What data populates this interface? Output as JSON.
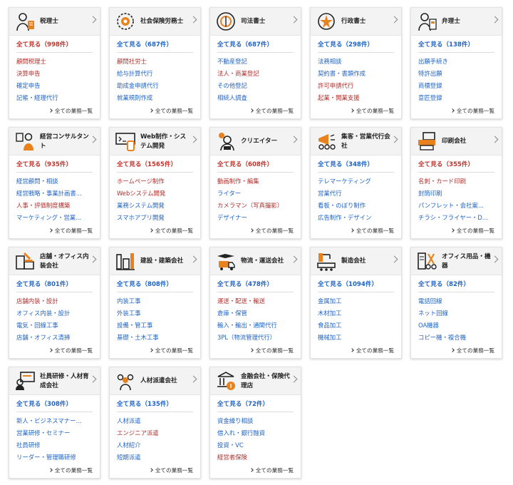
{
  "more_label": "全ての業務一覧",
  "colors": {
    "red": "#b0302c",
    "blue": "#1f64c4",
    "orange": "#e8821e"
  },
  "cards": [
    {
      "title": "税理士",
      "icon": "tax-accountant-icon",
      "see_all": "全て見る（998件）",
      "tone": "red",
      "items": [
        {
          "t": "顧問税理士",
          "c": "red"
        },
        {
          "t": "決算申告",
          "c": "red"
        },
        {
          "t": "確定申告",
          "c": "blue"
        },
        {
          "t": "記帳・経理代行",
          "c": "blue"
        }
      ]
    },
    {
      "title": "社会保険労務士",
      "icon": "labor-consultant-icon",
      "see_all": "全て見る（687件）",
      "tone": "blue",
      "items": [
        {
          "t": "顧問社労士",
          "c": "red"
        },
        {
          "t": "給与計算代行",
          "c": "blue"
        },
        {
          "t": "助成金申請代行",
          "c": "blue"
        },
        {
          "t": "就業規則作成",
          "c": "blue"
        }
      ]
    },
    {
      "title": "司法書士",
      "icon": "judicial-scrivener-icon",
      "see_all": "全て見る（687件）",
      "tone": "blue",
      "items": [
        {
          "t": "不動産登記",
          "c": "blue"
        },
        {
          "t": "法人・商業登記",
          "c": "red"
        },
        {
          "t": "その他登記",
          "c": "blue"
        },
        {
          "t": "相続人調査",
          "c": "blue"
        }
      ]
    },
    {
      "title": "行政書士",
      "icon": "administrative-scrivener-icon",
      "see_all": "全て見る（298件）",
      "tone": "blue",
      "items": [
        {
          "t": "法務相談",
          "c": "blue"
        },
        {
          "t": "契約書・書類作成",
          "c": "blue"
        },
        {
          "t": "許可申請代行",
          "c": "red"
        },
        {
          "t": "起業・開業支援",
          "c": "red"
        }
      ]
    },
    {
      "title": "弁理士",
      "icon": "patent-attorney-icon",
      "see_all": "全て見る（138件）",
      "tone": "blue",
      "items": [
        {
          "t": "出願手続き",
          "c": "blue"
        },
        {
          "t": "特許出願",
          "c": "blue"
        },
        {
          "t": "商標登録",
          "c": "blue"
        },
        {
          "t": "意匠登録",
          "c": "blue"
        }
      ]
    },
    {
      "title": "経営コンサルタント",
      "icon": "management-consultant-icon",
      "see_all": "全て見る（935件）",
      "tone": "red",
      "items": [
        {
          "t": "経営顧問・相談",
          "c": "blue"
        },
        {
          "t": "経営戦略・事業計画書...",
          "c": "blue"
        },
        {
          "t": "人事・評価制度構築",
          "c": "red"
        },
        {
          "t": "マーケティング・営業...",
          "c": "blue"
        }
      ]
    },
    {
      "title": "Web制作・システム開発",
      "icon": "web-development-icon",
      "see_all": "全て見る（1565件）",
      "tone": "red",
      "items": [
        {
          "t": "ホームページ制作",
          "c": "red"
        },
        {
          "t": "Webシステム開発",
          "c": "red"
        },
        {
          "t": "業務システム開発",
          "c": "blue"
        },
        {
          "t": "スマホアプリ開発",
          "c": "blue"
        }
      ]
    },
    {
      "title": "クリエイター",
      "icon": "creator-icon",
      "see_all": "全て見る（608件）",
      "tone": "red",
      "items": [
        {
          "t": "動画制作・編集",
          "c": "red"
        },
        {
          "t": "ライター",
          "c": "blue"
        },
        {
          "t": "カメラマン（写真撮影）",
          "c": "red"
        },
        {
          "t": "デザイナー",
          "c": "blue"
        }
      ]
    },
    {
      "title": "集客・営業代行会社",
      "icon": "sales-agency-icon",
      "see_all": "全て見る（348件）",
      "tone": "blue",
      "items": [
        {
          "t": "テレマーケティング",
          "c": "blue"
        },
        {
          "t": "営業代行",
          "c": "blue"
        },
        {
          "t": "看板・のぼり制作",
          "c": "blue"
        },
        {
          "t": "広告制作・デザイン",
          "c": "blue"
        }
      ]
    },
    {
      "title": "印刷会社",
      "icon": "printing-company-icon",
      "see_all": "全て見る（355件）",
      "tone": "red",
      "items": [
        {
          "t": "名刺・カード印刷",
          "c": "red"
        },
        {
          "t": "封筒印刷",
          "c": "blue"
        },
        {
          "t": "パンフレット・会社案...",
          "c": "blue"
        },
        {
          "t": "チラシ・フライヤー・D...",
          "c": "blue"
        }
      ]
    },
    {
      "title": "店舗・オフィス内装会社",
      "icon": "interior-company-icon",
      "see_all": "全て見る（801件）",
      "tone": "blue",
      "items": [
        {
          "t": "店舗内装・設計",
          "c": "red"
        },
        {
          "t": "オフィス内装・設計",
          "c": "blue"
        },
        {
          "t": "電気・回線工事",
          "c": "blue"
        },
        {
          "t": "店舗・オフィス清掃",
          "c": "blue"
        }
      ]
    },
    {
      "title": "建設・建築会社",
      "icon": "construction-company-icon",
      "see_all": "全て見る（808件）",
      "tone": "blue",
      "items": [
        {
          "t": "内装工事",
          "c": "blue"
        },
        {
          "t": "外装工事",
          "c": "blue"
        },
        {
          "t": "設備・管工事",
          "c": "blue"
        },
        {
          "t": "基礎・土木工事",
          "c": "blue"
        }
      ]
    },
    {
      "title": "物流・運送会社",
      "icon": "logistics-company-icon",
      "see_all": "全て見る（478件）",
      "tone": "blue",
      "items": [
        {
          "t": "運送・配送・輸送",
          "c": "red"
        },
        {
          "t": "倉庫・保管",
          "c": "blue"
        },
        {
          "t": "輸入・輸出・通関代行",
          "c": "blue"
        },
        {
          "t": "3PL（物流管理代行）",
          "c": "blue"
        }
      ]
    },
    {
      "title": "製造会社",
      "icon": "manufacturing-company-icon",
      "see_all": "全て見る（1094件）",
      "tone": "blue",
      "items": [
        {
          "t": "金属加工",
          "c": "blue"
        },
        {
          "t": "木材加工",
          "c": "blue"
        },
        {
          "t": "食品加工",
          "c": "blue"
        },
        {
          "t": "機械加工",
          "c": "blue"
        }
      ]
    },
    {
      "title": "オフィス用品・機器",
      "icon": "office-supplies-icon",
      "see_all": "全て見る（82件）",
      "tone": "blue",
      "items": [
        {
          "t": "電話回線",
          "c": "blue"
        },
        {
          "t": "ネット回線",
          "c": "blue"
        },
        {
          "t": "OA機器",
          "c": "blue"
        },
        {
          "t": "コピー機・複合機",
          "c": "blue"
        }
      ]
    },
    {
      "title": "社員研修・人材育成会社",
      "icon": "employee-training-icon",
      "see_all": "全て見る（308件）",
      "tone": "blue",
      "items": [
        {
          "t": "新人・ビジネスマナー...",
          "c": "blue"
        },
        {
          "t": "営業研修・セミナー",
          "c": "blue"
        },
        {
          "t": "社員研修",
          "c": "blue"
        },
        {
          "t": "リーダー・管理職研修",
          "c": "blue"
        }
      ]
    },
    {
      "title": "人材派遣会社",
      "icon": "staffing-agency-icon",
      "see_all": "全て見る（135件）",
      "tone": "blue",
      "items": [
        {
          "t": "人材派遣",
          "c": "blue"
        },
        {
          "t": "エンジニア派遣",
          "c": "red"
        },
        {
          "t": "人材紹介",
          "c": "blue"
        },
        {
          "t": "短期派遣",
          "c": "blue"
        }
      ]
    },
    {
      "title": "金融会社・保険代理店",
      "icon": "finance-insurance-icon",
      "see_all": "全て見る（72件）",
      "tone": "blue",
      "items": [
        {
          "t": "資金繰り相談",
          "c": "blue"
        },
        {
          "t": "借入れ・銀行融資",
          "c": "blue"
        },
        {
          "t": "投資・VC",
          "c": "blue"
        },
        {
          "t": "経営者保険",
          "c": "red"
        }
      ]
    }
  ]
}
